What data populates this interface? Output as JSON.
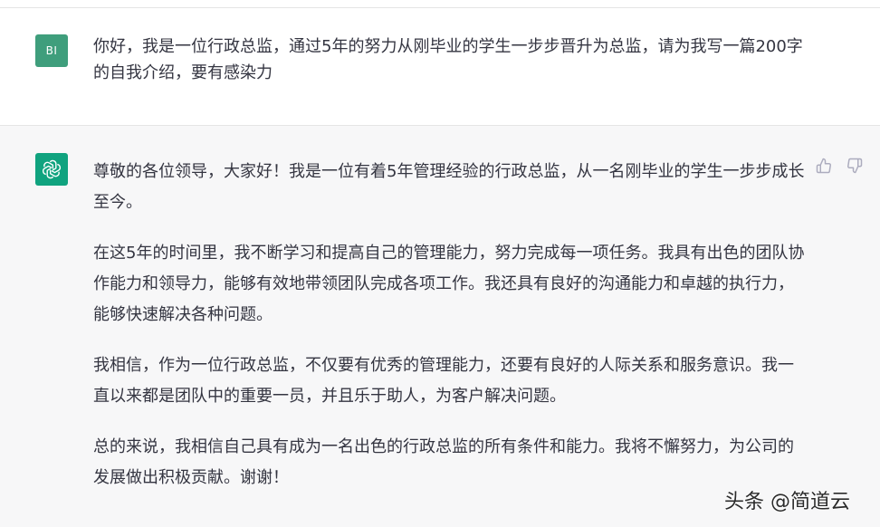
{
  "user_message": {
    "avatar_initials": "BI",
    "text": "你好，我是一位行政总监，通过5年的努力从刚毕业的学生一步步晋升为总监，请为我写一篇200字的自我介绍，要有感染力"
  },
  "assistant_message": {
    "avatar_icon": "openai-logo-icon",
    "paragraphs": [
      "尊敬的各位领导，大家好！我是一位有着5年管理经验的行政总监，从一名刚毕业的学生一步步成长至今。",
      "在这5年的时间里，我不断学习和提高自己的管理能力，努力完成每一项任务。我具有出色的团队协作能力和领导力，能够有效地带领团队完成各项工作。我还具有良好的沟通能力和卓越的执行力，能够快速解决各种问题。",
      "我相信，作为一位行政总监，不仅要有优秀的管理能力，还要有良好的人际关系和服务意识。我一直以来都是团队中的重要一员，并且乐于助人，为客户解决问题。",
      "总的来说，我相信自己具有成为一名出色的行政总监的所有条件和能力。我将不懈努力，为公司的发展做出积极贡献。谢谢！"
    ],
    "feedback": {
      "thumbs_up_icon": "thumbs-up-icon",
      "thumbs_down_icon": "thumbs-down-icon"
    }
  },
  "watermark": "头条 @简道云",
  "colors": {
    "user_avatar": "#3f9e7c",
    "bot_avatar": "#10a37f",
    "assistant_bg": "#f7f7f8",
    "text": "#343541",
    "icon": "#acacbe"
  }
}
